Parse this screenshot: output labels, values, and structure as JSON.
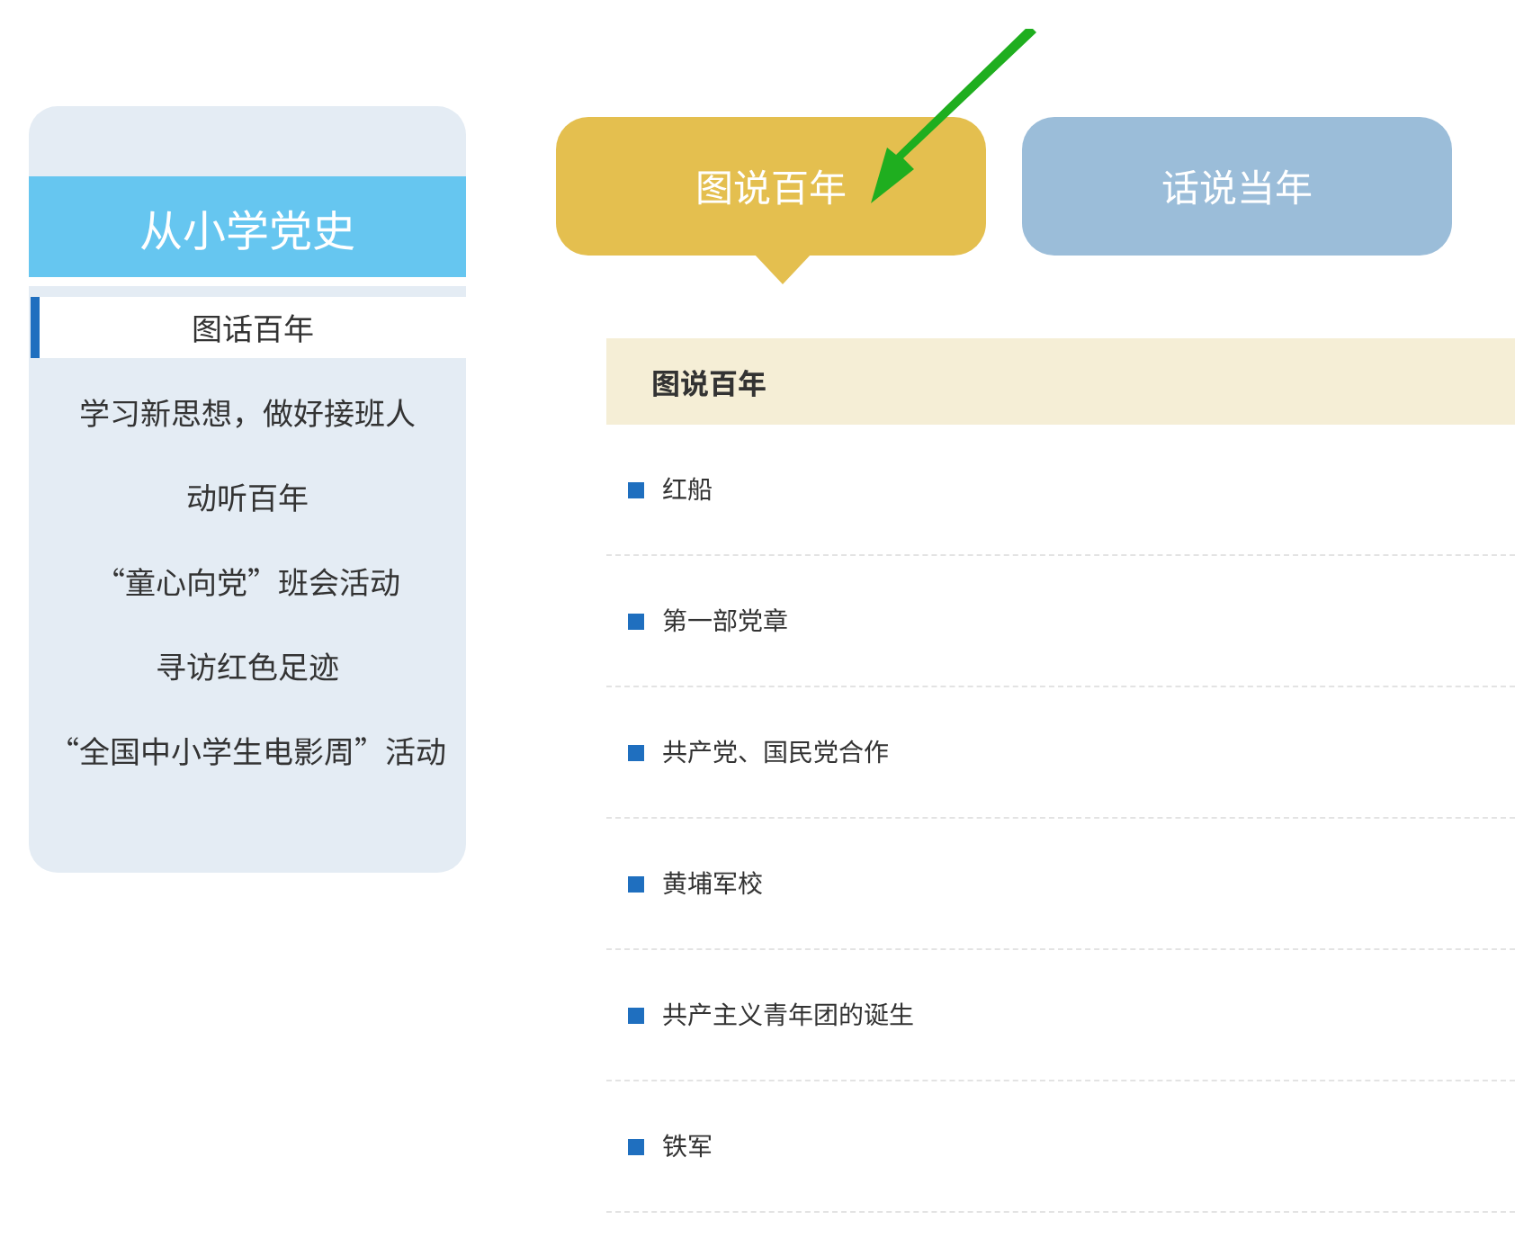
{
  "sidebar": {
    "title": "从小学党史",
    "items": [
      {
        "label": "图话百年",
        "selected": true
      },
      {
        "label": "学习新思想，做好接班人",
        "selected": false
      },
      {
        "label": "动听百年",
        "selected": false
      },
      {
        "label": "“童心向党”班会活动",
        "selected": false
      },
      {
        "label": "寻访红色足迹",
        "selected": false
      },
      {
        "label": "“全国中小学生电影周”活动",
        "selected": false
      }
    ]
  },
  "tabs": [
    {
      "label": "图说百年",
      "selected": true
    },
    {
      "label": "话说当年",
      "selected": false
    }
  ],
  "section": {
    "title": "图说百年",
    "items": [
      "红船",
      "第一部党章",
      "共产党、国民党合作",
      "黄埔军校",
      "共产主义青年团的诞生",
      "铁军"
    ]
  }
}
